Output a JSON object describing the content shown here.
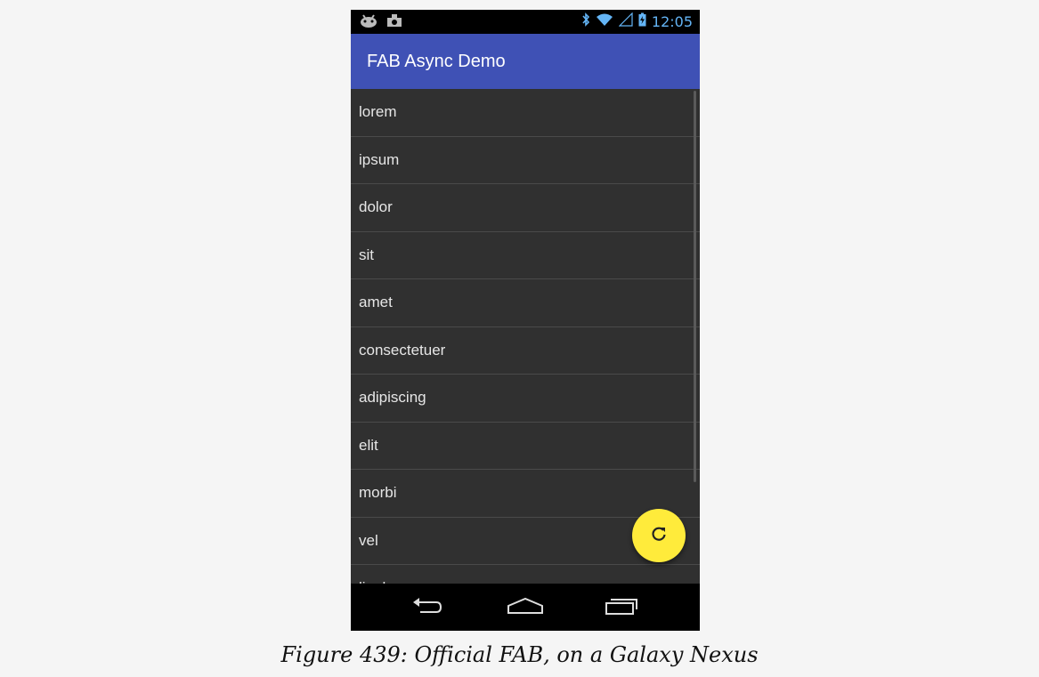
{
  "status_bar": {
    "time": "12:05",
    "left_icons": [
      "android-icon",
      "camera-icon"
    ],
    "right_icons": [
      "bluetooth-icon",
      "wifi-icon",
      "signal-icon",
      "battery-charging-icon"
    ]
  },
  "app_bar": {
    "title": "FAB Async Demo",
    "color": "#3f51b5"
  },
  "list": {
    "items": [
      "lorem",
      "ipsum",
      "dolor",
      "sit",
      "amet",
      "consectetuer",
      "adipiscing",
      "elit",
      "morbi",
      "vel",
      "ligula"
    ]
  },
  "fab": {
    "icon": "refresh-icon",
    "color": "#ffeb3b"
  },
  "nav_bar": {
    "icons": [
      "back-icon",
      "home-icon",
      "recents-icon"
    ]
  },
  "caption": "Figure 439: Official FAB, on a Galaxy Nexus"
}
